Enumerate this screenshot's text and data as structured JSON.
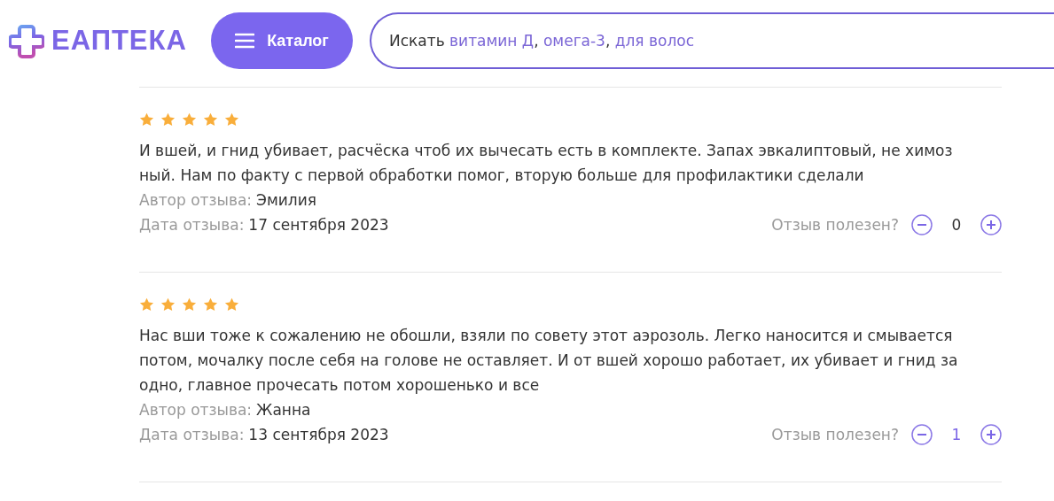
{
  "header": {
    "logo": "ЕАПТЕКА",
    "catalog_button": "Каталог",
    "search": {
      "label": "Искать",
      "suggestions": [
        "витамин Д",
        "омега-3",
        "для волос"
      ],
      "separator": ","
    }
  },
  "reviews": [
    {
      "stars": 5,
      "lines": [
        "И вшей, и гнид убивает, расчёска чтоб их вычесать есть в комплекте. Запах эвкалиптовый, не химоз",
        "ный. Нам по факту с первой обработки помог, вторую больше для профилактики сделали"
      ],
      "author_label": "Автор отзыва:",
      "author": "Эмилия",
      "date_label": "Дата отзыва:",
      "date": "17 сентября 2023",
      "helpful_label": "Отзыв полезен?",
      "count": "0",
      "count_highlighted": false
    },
    {
      "stars": 5,
      "lines": [
        "Нас вши тоже к сожалению не обошли, взяли по совету этот аэрозоль. Легко наносится и смывается",
        "потом, мочалку после себя на голове не оставляет. И от вшей хорошо работает, их убивает и гнид за",
        "одно, главное прочесать потом хорошенько и все"
      ],
      "author_label": "Автор отзыва:",
      "author": "Жанна",
      "date_label": "Дата отзыва:",
      "date": "13 сентября 2023",
      "helpful_label": "Отзыв полезен?",
      "count": "1",
      "count_highlighted": true
    }
  ]
}
